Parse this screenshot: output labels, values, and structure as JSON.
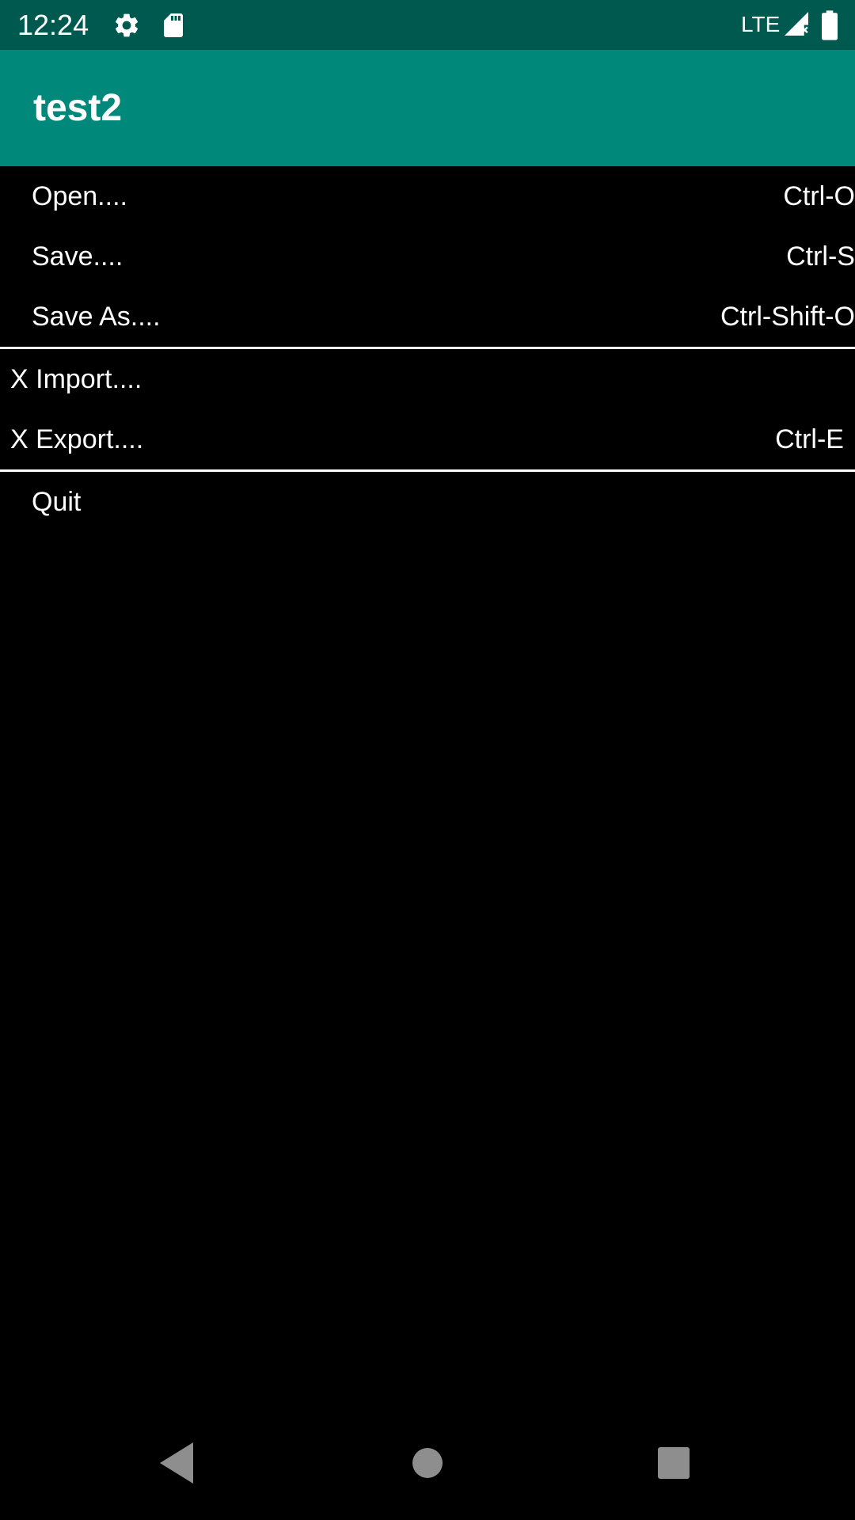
{
  "status_bar": {
    "time": "12:24",
    "network": "LTE",
    "icons": [
      "settings-gear-icon",
      "sd-card-icon",
      "signal-no-data-icon",
      "battery-full-icon"
    ]
  },
  "app_bar": {
    "title": "test2",
    "color": "#00897b",
    "status_color": "#00594f"
  },
  "menu": {
    "group1": [
      {
        "label": "Open....",
        "shortcut": "Ctrl-O"
      },
      {
        "label": "Save....",
        "shortcut": "Ctrl-S"
      },
      {
        "label": "Save As....",
        "shortcut": "Ctrl-Shift-O"
      }
    ],
    "group2": [
      {
        "label": "X Import....",
        "shortcut": ""
      },
      {
        "label": "X Export....",
        "shortcut": "Ctrl-E"
      }
    ],
    "group3": [
      {
        "label": "Quit",
        "shortcut": ""
      }
    ]
  },
  "nav_bar": {
    "buttons": [
      "back-triangle-icon",
      "home-circle-icon",
      "recents-square-icon"
    ]
  }
}
